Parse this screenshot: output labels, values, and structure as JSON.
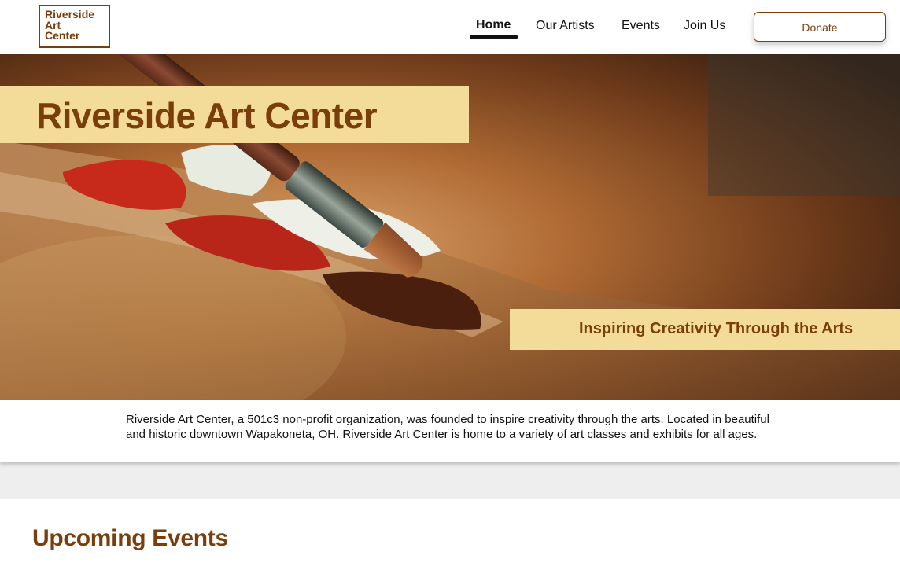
{
  "logo": {
    "lines": [
      "Riverside",
      "Art",
      "Center"
    ],
    "icon": "crescent-moon-icon"
  },
  "nav": {
    "items": [
      {
        "label": "Home",
        "active": true
      },
      {
        "label": "Our Artists",
        "active": false
      },
      {
        "label": "Events",
        "active": false
      },
      {
        "label": "Join Us",
        "active": false
      }
    ],
    "donate_label": "Donate"
  },
  "hero": {
    "title": "Riverside Art Center",
    "tagline": "Inspiring Creativity Through the Arts",
    "image": "paint-palette-and-brush-photo"
  },
  "intro": {
    "text": "Riverside Art Center, a 501c3 non-profit organization, was founded to inspire creativity through the arts. Located in beautiful and historic downtown Wapakoneta, OH. Riverside Art Center is home to a variety of art classes and exhibits for all ages."
  },
  "events": {
    "title": "Upcoming Events"
  },
  "colors": {
    "brand_brown": "#7a3e0c",
    "banner_yellow": "#f3dc9a",
    "band_gray": "#eeeeee"
  }
}
